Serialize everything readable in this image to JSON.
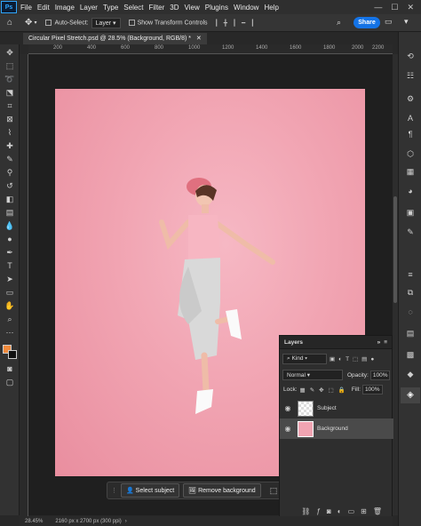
{
  "menubar": {
    "logo": "Ps",
    "items": [
      "File",
      "Edit",
      "Image",
      "Layer",
      "Type",
      "Select",
      "Filter",
      "3D",
      "View",
      "Plugins",
      "Window",
      "Help"
    ]
  },
  "options": {
    "auto_select": "Auto-Select:",
    "layer_select": "Layer",
    "show_transform": "Show Transform Controls",
    "share": "Share"
  },
  "document": {
    "tab_title": "Circular Pixel Stretch.psd @ 28.5% (Background, RGB/8) *",
    "ruler_ticks": [
      "200",
      "400",
      "600",
      "800",
      "1000",
      "1200",
      "1400",
      "1600",
      "1800",
      "2000",
      "2200"
    ]
  },
  "context_bar": {
    "select_subject": "Select subject",
    "remove_background": "Remove background"
  },
  "layers_panel": {
    "title": "Layers",
    "kind": "Kind",
    "blend_mode": "Normal",
    "opacity_label": "Opacity:",
    "opacity_value": "100%",
    "lock_label": "Lock:",
    "fill_label": "Fill:",
    "fill_value": "100%",
    "layers": [
      {
        "name": "Subject",
        "selected": false
      },
      {
        "name": "Background",
        "selected": true
      }
    ]
  },
  "status": {
    "zoom": "28.45%",
    "doc_size": "2160 px x 2700 px (300 ppi)"
  },
  "colors": {
    "foreground": "#f08a3c",
    "background": "#111111",
    "accent": "#1473e6",
    "canvas_pink": "#f1a4b2"
  }
}
